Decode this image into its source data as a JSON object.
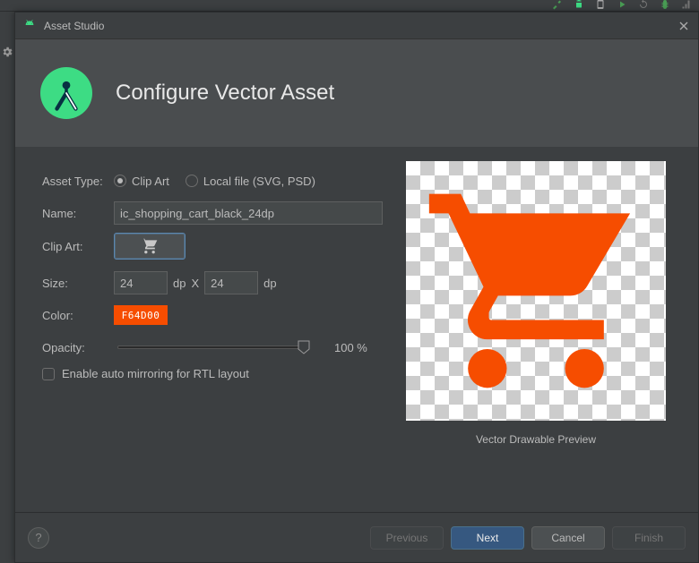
{
  "window": {
    "title": "Asset Studio"
  },
  "header": {
    "title": "Configure Vector Asset"
  },
  "form": {
    "asset_type_label": "Asset Type:",
    "radio_clipart": "Clip Art",
    "radio_localfile": "Local file (SVG, PSD)",
    "name_label": "Name:",
    "name_value": "ic_shopping_cart_black_24dp",
    "clipart_label": "Clip Art:",
    "size_label": "Size:",
    "size_w": "24",
    "size_h": "24",
    "size_x": "X",
    "size_unit": "dp",
    "color_label": "Color:",
    "color_hex": "F64D00",
    "opacity_label": "Opacity:",
    "opacity_value": "100 %",
    "mirroring_label": "Enable auto mirroring for RTL layout"
  },
  "preview": {
    "label": "Vector Drawable Preview"
  },
  "footer": {
    "previous": "Previous",
    "next": "Next",
    "cancel": "Cancel",
    "finish": "Finish",
    "help": "?"
  },
  "colors": {
    "accent": "#F64D00",
    "primary_btn": "#365880"
  }
}
